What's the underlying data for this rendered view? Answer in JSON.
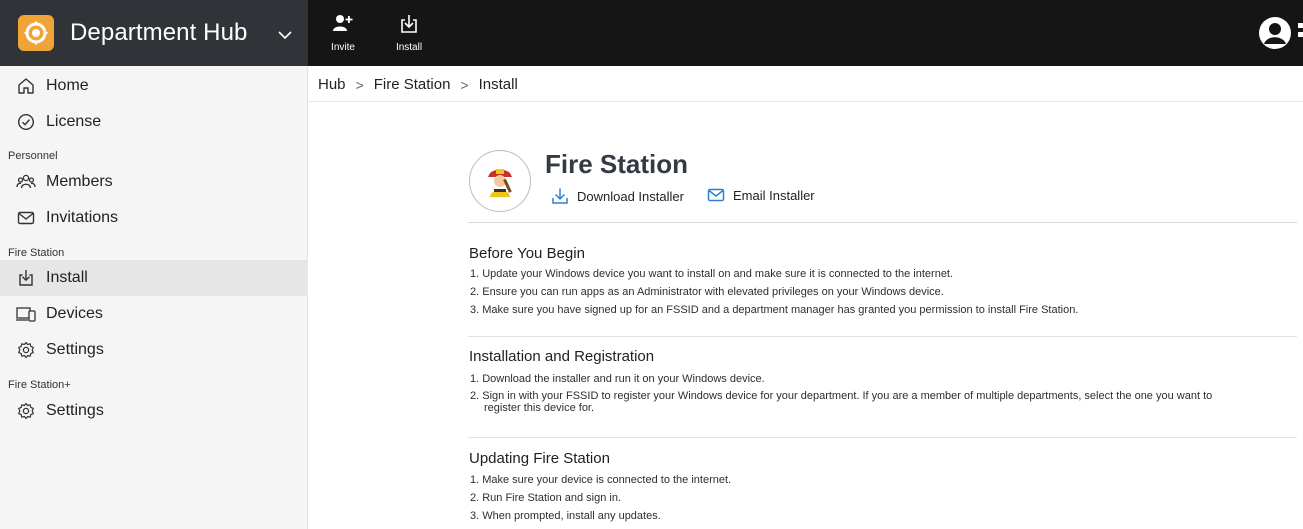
{
  "app": {
    "title": "Department Hub"
  },
  "toolbar": {
    "invite_label": "Invite",
    "install_label": "Install"
  },
  "sidebar": {
    "items": [
      {
        "label": "Home",
        "icon": "home-icon"
      },
      {
        "label": "License",
        "icon": "check-circle-icon"
      }
    ],
    "sections": [
      {
        "title": "Personnel",
        "items": [
          {
            "label": "Members",
            "icon": "members-icon"
          },
          {
            "label": "Invitations",
            "icon": "envelope-icon"
          }
        ]
      },
      {
        "title": "Fire Station",
        "items": [
          {
            "label": "Install",
            "icon": "install-icon",
            "active": true
          },
          {
            "label": "Devices",
            "icon": "devices-icon"
          },
          {
            "label": "Settings",
            "icon": "gear-icon"
          }
        ]
      },
      {
        "title": "Fire Station+",
        "items": [
          {
            "label": "Settings",
            "icon": "gear-icon"
          }
        ]
      }
    ]
  },
  "breadcrumb": [
    "Hub",
    "Fire Station",
    "Install"
  ],
  "product": {
    "name": "Fire Station",
    "download_label": "Download Installer",
    "email_label": "Email Installer"
  },
  "sections": [
    {
      "title": "Before You Begin",
      "steps": [
        "1. Update your Windows device you want to install on and make sure it is connected to the internet.",
        "2. Ensure you can run apps as an Administrator with elevated privileges on your Windows device.",
        "3. Make sure you have signed up for an FSSID and a department manager has granted you permission to install Fire Station."
      ]
    },
    {
      "title": "Installation and Registration",
      "steps": [
        "1. Download the installer and run it on your Windows device.",
        "2. Sign in with your FSSID to register your Windows device for your department. If you are a member of multiple departments, select the one you want to",
        "register this device for."
      ]
    },
    {
      "title": "Updating Fire Station",
      "steps": [
        "1. Make sure your device is connected to the internet.",
        "2. Run Fire Station and sign in.",
        "3. When prompted, install any updates."
      ]
    }
  ],
  "colors": {
    "topbar": "#151515",
    "brand_bg": "#303338",
    "logo": "#f0a336",
    "accent_blue": "#2f7fd6",
    "sidebar_bg": "#f5f5f5",
    "active_bg": "#e6e6e6"
  }
}
